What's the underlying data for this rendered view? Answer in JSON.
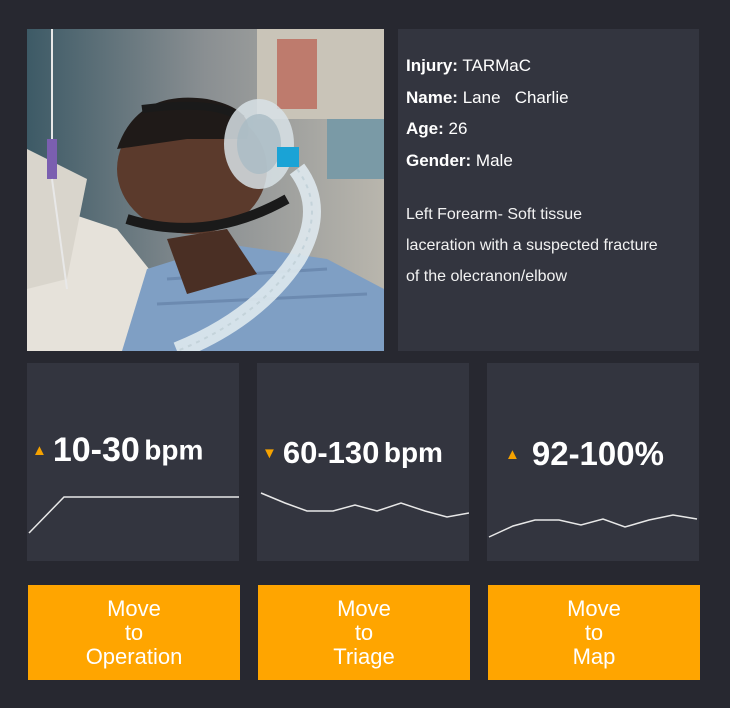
{
  "patient": {
    "injury_label": "Injury:",
    "injury_value": "TARMaC",
    "name_label": "Name:",
    "name_value": "Lane   Charlie",
    "age_label": "Age:",
    "age_value": "26",
    "gender_label": "Gender:",
    "gender_value": "Male",
    "description_lines": [
      "Left Forearm- Soft tissue",
      "laceration with a suspected fracture",
      "of the olecranon/elbow"
    ]
  },
  "vitals": [
    {
      "trend": "up",
      "range": "10-30",
      "unit": "bpm"
    },
    {
      "trend": "down",
      "range": "60-130",
      "unit": "bpm"
    },
    {
      "trend": "up",
      "range": "92-100%",
      "unit": ""
    }
  ],
  "buttons": [
    {
      "line1": "Move",
      "line2": "to",
      "line3": "Operation"
    },
    {
      "line1": "Move",
      "line2": "to",
      "line3": "Triage"
    },
    {
      "line1": "Move",
      "line2": "to",
      "line3": "Map"
    }
  ],
  "colors": {
    "background": "#272830",
    "panel": "#33353f",
    "accent": "#ffa500",
    "arrow": "#f5a200"
  },
  "icons": {
    "up": "triangle-up-icon",
    "down": "triangle-down-icon"
  }
}
